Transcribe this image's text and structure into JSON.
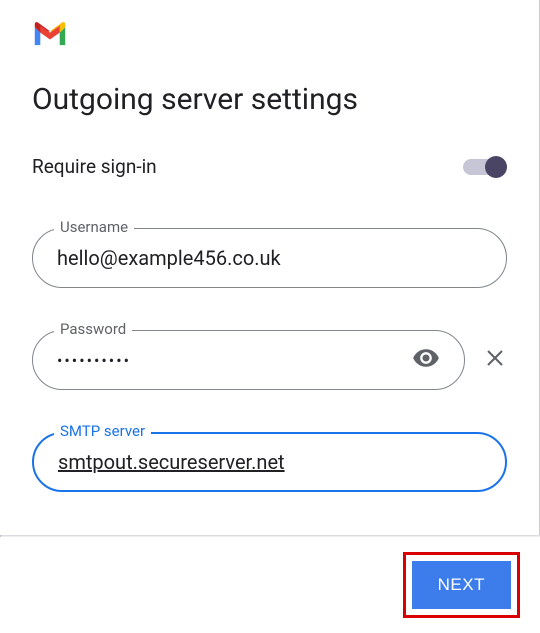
{
  "header": {
    "title": "Outgoing server settings"
  },
  "toggle": {
    "label": "Require sign-in"
  },
  "fields": {
    "username": {
      "label": "Username",
      "value": "hello@example456.co.uk"
    },
    "password": {
      "label": "Password",
      "value": "••••••••••"
    },
    "smtp": {
      "label": "SMTP server",
      "value": "smtpout.secureserver.net"
    }
  },
  "footer": {
    "next_label": "NEXT"
  }
}
